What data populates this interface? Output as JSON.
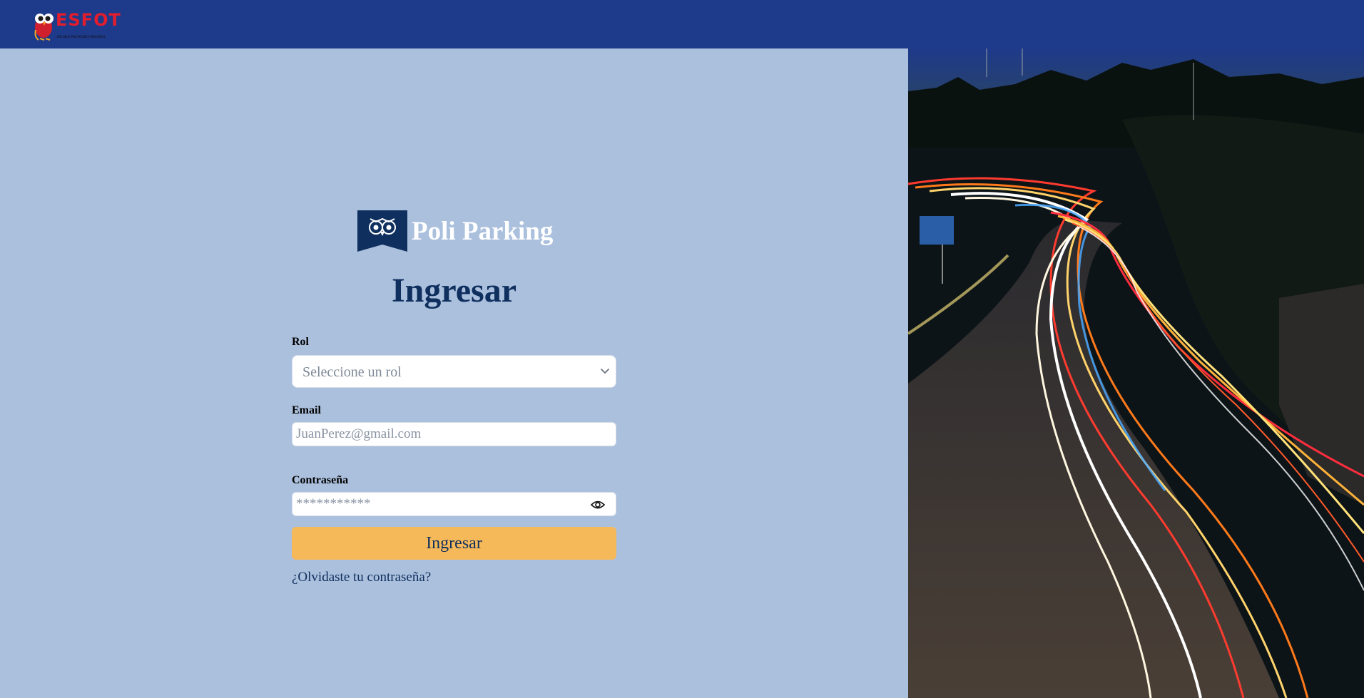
{
  "header": {
    "logo_text": "ESFOT",
    "logo_subtitle": "ESCUELA POLITÉCNICA NACIONAL"
  },
  "brand": {
    "name": "Poli Parking"
  },
  "login": {
    "title": "Ingresar",
    "role_label": "Rol",
    "role_placeholder": "Seleccione un rol",
    "email_label": "Email",
    "email_placeholder": "JuanPerez@gmail.com",
    "password_label": "Contraseña",
    "password_placeholder": "***********",
    "submit_label": "Ingresar",
    "forgot_link": "¿Olvidaste tu contraseña?"
  },
  "colors": {
    "header_bg": "#1e3a8a",
    "pane_bg": "#abc0dd",
    "title": "#0f2f5e",
    "button": "#f5b95a"
  },
  "icons": [
    "esfot-owl-icon",
    "owl-badge-icon",
    "chevron-down-icon",
    "eye-icon"
  ]
}
